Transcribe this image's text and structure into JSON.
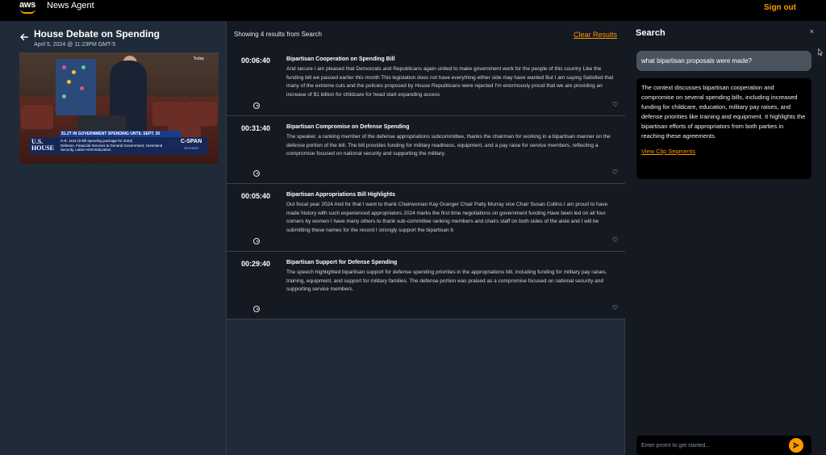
{
  "topbar": {
    "logo_text": "aws",
    "app_name": "News Agent",
    "sign_out": "Sign out",
    "brand_color": "#ff9900"
  },
  "video": {
    "title": "House Debate on Spending",
    "date": "April 5, 2024 @ 11:23PM GMT-5",
    "overlay_today": "Today",
    "overlay_ticker": "$1.2T IN GOVERNMENT SPENDING UNTIL SEPT. 30",
    "overlay_bill": "H.R. 1102 (6-bill spending package for 2024)",
    "overlay_bill_detail": "Defense, Financial Services & General Government, Homeland Security, Labor-HHS-Education",
    "overlay_house": "U.S. HOUSE",
    "overlay_network": "C-SPAN",
    "overlay_network_sub": "45YEARS"
  },
  "results_header": {
    "count_text": "Showing 4 results from Search",
    "clear_label": "Clear Results"
  },
  "results": [
    {
      "time": "00:06:40",
      "title": "Bipartisan Cooperation on Spending Bill",
      "text": "And secure I am pleased that Democrats and Republicans again united to make government work for the people of this country Like the funding bill we passed earlier this month This legislation does not have everything either side may have wanted But I am saying Satisfied that many of the extreme cuts and the policies proposed by House Republicans were rejected I'm enormously proud that we are providing an increase of $1 billion for childcare for head start expanding access"
    },
    {
      "time": "00:31:40",
      "title": "Bipartisan Compromise on Defense Spending",
      "text": "The speaker, a ranking member of the defense appropriations subcommittee, thanks the chairman for working in a bipartisan manner on the defense portion of the bill. The bill provides funding for military readiness, equipment, and a pay raise for service members, reflecting a compromise focused on national security and supporting the military."
    },
    {
      "time": "00:05:40",
      "title": "Bipartisan Appropriations Bill Highlights",
      "text": "Out fiscal year 2024 And for that I want to thank Chairwoman Kay Granger Chair Patty Murray vice Chair Susan Collins I am proud to have made history with such experienced appropriators 2024 marks the first time negotiations on government funding Have been led on all four corners by women I have many others to thank sub-committee ranking members and chairs staff on both sides of the aisle and I will be submitting these names for the record I strongly support the bipartisan b"
    },
    {
      "time": "00:29:40",
      "title": "Bipartisan Support for Defense Spending",
      "text": "The speech highlighted bipartisan support for defense spending priorities in the appropriations bill, including funding for military pay raises, training, equipment, and support for military families. The defense portion was praised as a compromise focused on national security and supporting service members."
    }
  ],
  "search_panel": {
    "title": "Search",
    "close": "×",
    "query": "what bipartisan proposals were made?",
    "answer": "The context discusses bipartisan cooperation and compromise on several spending bills, including increased funding for childcare, education, military pay raises, and defense priorities like training and equipment. It highlights the bipartisan efforts of appropriators from both parties in reaching these agreements.",
    "link_label": "View Clip Segments",
    "prompt_placeholder": "Enter promt to get started..."
  }
}
